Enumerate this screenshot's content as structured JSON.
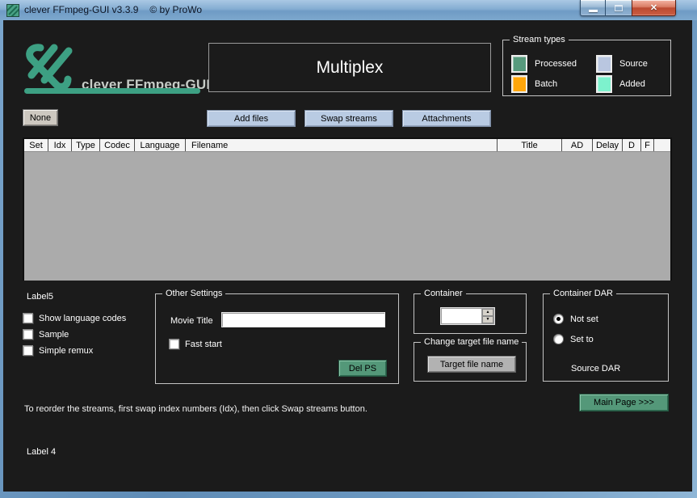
{
  "window": {
    "title": "clever FFmpeg-GUI v3.3.9",
    "subtitle": "© by ProWo"
  },
  "header": {
    "logo_text": "clever FFmpeg-GUI",
    "page_title": "Multiplex",
    "none_button": "None"
  },
  "stream_types": {
    "title": "Stream types",
    "items": [
      {
        "label": "Processed",
        "color": "#579a7d"
      },
      {
        "label": "Source",
        "color": "#b9c6e0"
      },
      {
        "label": "Batch",
        "color": "#ffa60a"
      },
      {
        "label": "Added",
        "color": "#7df2cd"
      }
    ]
  },
  "toolbar": {
    "add_files": "Add files",
    "swap_streams": "Swap streams",
    "attachments": "Attachments"
  },
  "table": {
    "columns": [
      "Set",
      "Idx",
      "Type",
      "Codec",
      "Language",
      "Filename",
      "Title",
      "AD",
      "Delay",
      "D",
      "F"
    ],
    "rows": []
  },
  "left_panel": {
    "label5": "Label5",
    "checkboxes": [
      {
        "label": "Show language codes",
        "checked": false
      },
      {
        "label": "Sample",
        "checked": false
      },
      {
        "label": "Simple remux",
        "checked": false
      }
    ]
  },
  "other_settings": {
    "title": "Other Settings",
    "movie_title_label": "Movie Title",
    "movie_title_value": "",
    "fast_start_label": "Fast start",
    "fast_start_checked": false,
    "del_ps_button": "Del PS"
  },
  "container_group": {
    "title": "Container",
    "value": ""
  },
  "target_group": {
    "title": "Change target file name",
    "button": "Target file name"
  },
  "dar_group": {
    "title": "Container DAR",
    "options": [
      {
        "label": "Not set",
        "selected": true
      },
      {
        "label": "Set to",
        "selected": false
      }
    ],
    "source_dar_label": "Source DAR"
  },
  "footer": {
    "instruction": "To reorder the streams, first swap index numbers (Idx), then click Swap streams button.",
    "main_page_button": "Main Page >>>",
    "label4": "Label 4"
  },
  "colors": {
    "accent_teal": "#3da083",
    "teal_button": "#549879",
    "blue_button": "#b9cbe3",
    "grid_body": "#ababab",
    "client_background": "#1b1b1b",
    "close_button_red": "#bb4a31"
  }
}
